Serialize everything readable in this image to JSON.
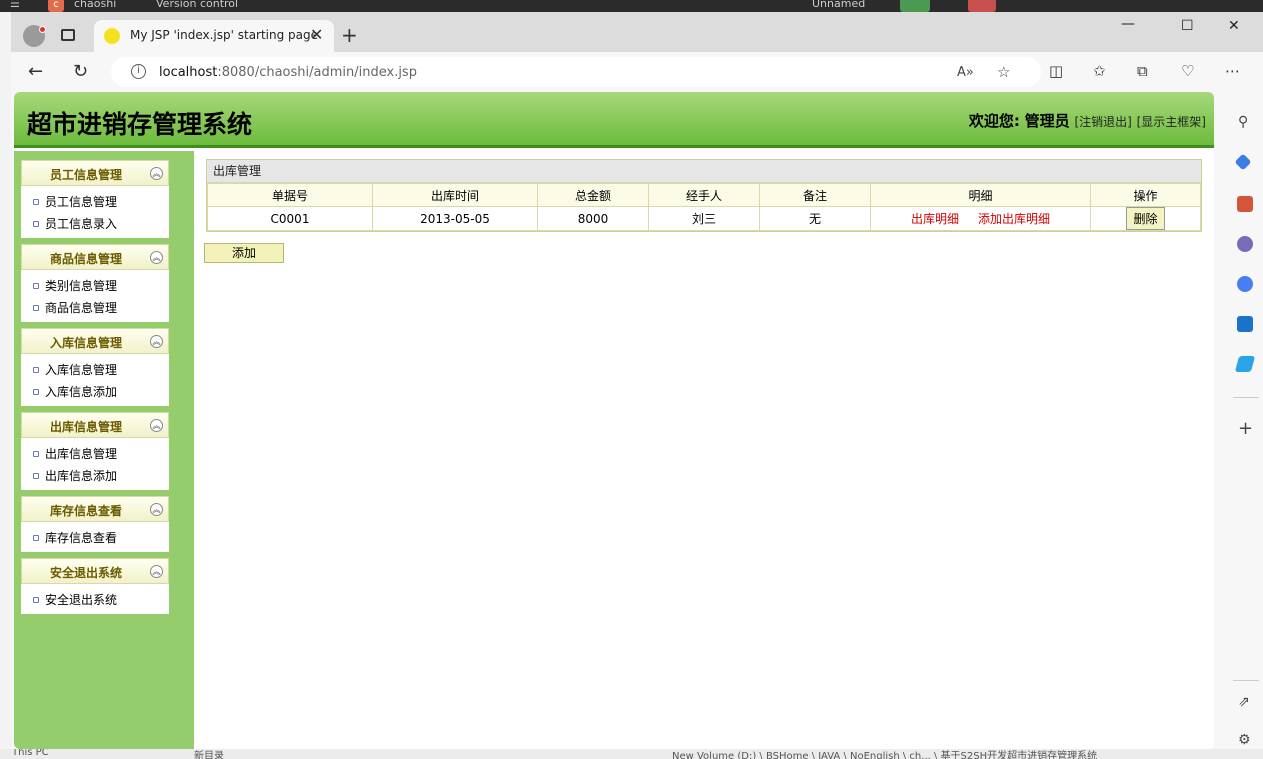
{
  "os": {
    "app_badge": "c",
    "project": "chaoshi",
    "vcs": "Version control",
    "run_config": "Unnamed"
  },
  "bg_window": {
    "sidebar_label": "This PC",
    "file_name": "新目录",
    "path": "New Volume (D:) \\ BSHome \\ JAVA \\ NoEnglish \\ ch... \\ 基于S2SH开发超市进销存管理系统"
  },
  "browser": {
    "tab_title": "My JSP 'index.jsp' starting page",
    "url_host": "localhost",
    "url_rest": ":8080/chaoshi/admin/index.jsp"
  },
  "header": {
    "title": "超市进销存管理系统",
    "welcome_label": "欢迎您:",
    "user": "管理员",
    "logout": "[注销退出]",
    "show_main": "[显示主框架]"
  },
  "menu": [
    {
      "title": "员工信息管理",
      "items": [
        "员工信息管理",
        "员工信息录入"
      ]
    },
    {
      "title": "商品信息管理",
      "items": [
        "类别信息管理",
        "商品信息管理"
      ]
    },
    {
      "title": "入库信息管理",
      "items": [
        "入库信息管理",
        "入库信息添加"
      ]
    },
    {
      "title": "出库信息管理",
      "items": [
        "出库信息管理",
        "出库信息添加"
      ]
    },
    {
      "title": "库存信息查看",
      "items": [
        "库存信息查看"
      ]
    },
    {
      "title": "安全退出系统",
      "items": [
        "安全退出系统"
      ]
    }
  ],
  "table": {
    "caption": "出库管理",
    "columns": [
      "单据号",
      "出库时间",
      "总金额",
      "经手人",
      "备注",
      "明细",
      "操作"
    ],
    "rows": [
      {
        "id": "C0001",
        "date": "2013-05-05",
        "amount": "8000",
        "handler": "刘三",
        "note": "无",
        "detail_link": "出库明细",
        "add_detail_link": "添加出库明细",
        "action": "删除"
      }
    ]
  },
  "add_button": "添加",
  "colors": {
    "header_green": "#6cbb3c",
    "sidebar_green": "#96cd6c",
    "link_red": "#d20000"
  }
}
